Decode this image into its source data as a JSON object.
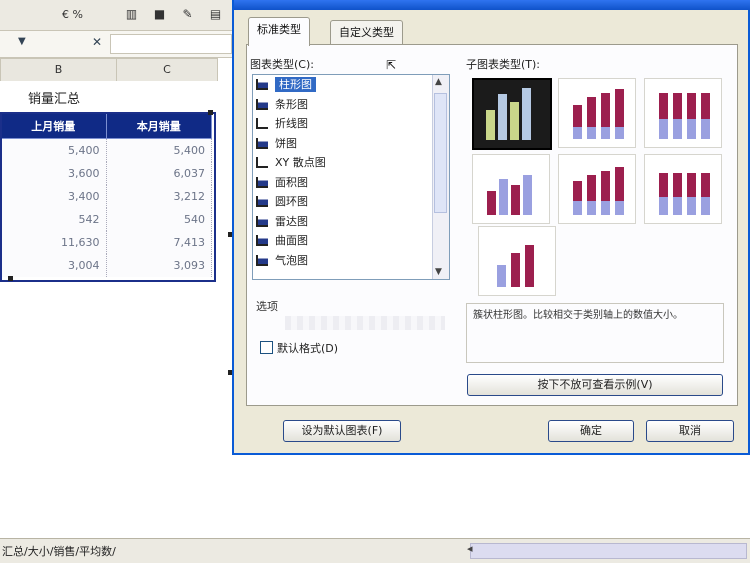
{
  "spreadsheet": {
    "toolbar_zoom": "€ %",
    "toolbar_icons": [
      "format-icon",
      "bold-icon",
      "paint-icon",
      "chart-icon"
    ],
    "formula_bar": {
      "name_box_arrow": "▼",
      "cancel": "✕"
    },
    "columns": [
      "B",
      "C"
    ],
    "sheet_title": "销量汇总",
    "table": {
      "headers": [
        "上月销量",
        "本月销量"
      ],
      "rows": [
        [
          "5,400",
          "5,400"
        ],
        [
          "3,600",
          "6,037"
        ],
        [
          "3,400",
          "3,212"
        ],
        [
          "542",
          "540"
        ],
        [
          "11,630",
          "7,413"
        ],
        [
          "3,004",
          "3,093"
        ]
      ]
    },
    "sheet_tabs": "汇总/大小/销售/平均数/"
  },
  "dialog": {
    "tabs": [
      "标准类型",
      "自定义类型"
    ],
    "chart_type_label": "图表类型(C):",
    "chart_types": [
      "柱形图",
      "条形图",
      "折线图",
      "饼图",
      "XY 散点图",
      "面积图",
      "圆环图",
      "雷达图",
      "曲面图",
      "气泡图"
    ],
    "selected_type_index": 0,
    "options_label": "选项",
    "checkbox_label": "默认格式(D)",
    "subtype_label": "子图表类型(T):",
    "description": "簇状柱形图。比较相交于类别轴上的数值大小。",
    "press_hold_button": "按下不放可查看示例(V)",
    "set_default_button": "设为默认图表(F)",
    "ok_button": "确定",
    "cancel_button": "取消",
    "colors": {
      "selection": "#316ac5",
      "header": "#102a86",
      "bar_accent": "#9c1f4e"
    }
  }
}
